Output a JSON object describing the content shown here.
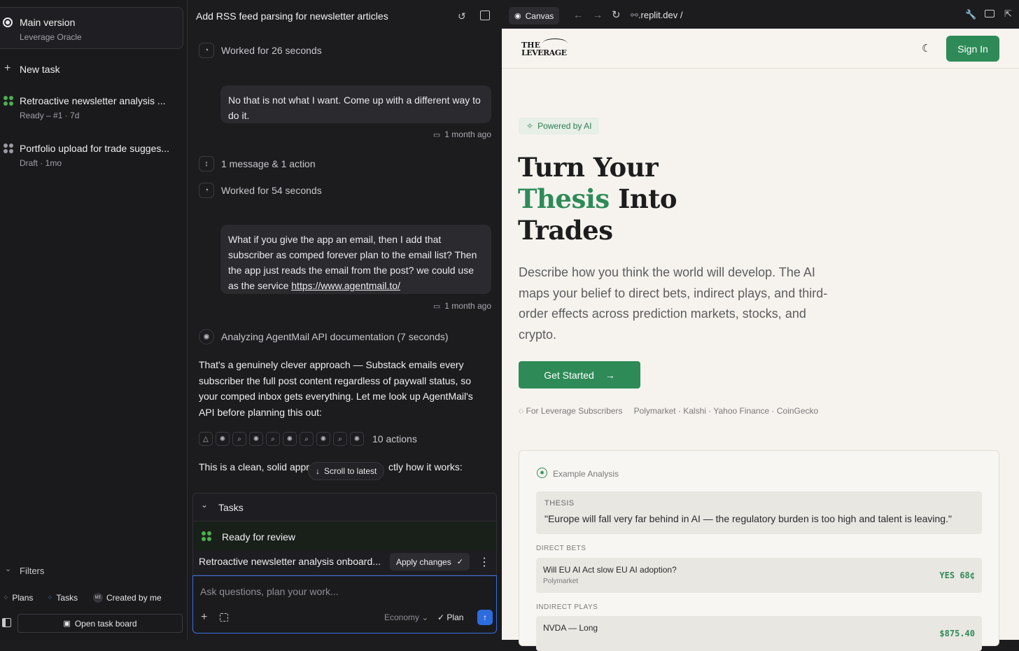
{
  "sidebar": {
    "main_version": {
      "title": "Main version",
      "subtitle": "Leverage Oracle"
    },
    "new_task_label": "New task",
    "tasks": [
      {
        "title": "Retroactive newsletter analysis ...",
        "meta": "Ready – #1 · 7d"
      },
      {
        "title": "Portfolio upload for trade sugges...",
        "meta": "Draft · 1mo"
      }
    ],
    "filters_label": "Filters",
    "chips": {
      "plans": "Plans",
      "tasks": "Tasks",
      "created_by_me": "Created by me",
      "avatar_initials": "ME"
    },
    "open_board_label": "Open task board"
  },
  "chat": {
    "title": "Add RSS feed parsing for newsletter articles",
    "worked_1": "Worked for 26 seconds",
    "msg_1": "No that is not what I want. Come up with a different way to do it.",
    "msg_1_time": "1 month ago",
    "collapsed": "1 message & 1 action",
    "worked_2": "Worked for 54 seconds",
    "msg_2_text": "What if you give the app an email, then I add that subscriber as comped forever plan to the email list? Then the app just reads the email from the post? we could use as the service ",
    "msg_2_link": "https://www.agentmail.to/",
    "msg_2_time": "1 month ago",
    "analyzing": "Analyzing AgentMail API documentation (7 seconds)",
    "reply": "That's a genuinely clever approach — Substack emails every subscriber the full post content regardless of paywall status, so your comped inbox gets everything. Let me look up AgentMail's API before planning this out:",
    "actions_count": "10 actions",
    "partial_start": "This is a clean, solid appr",
    "partial_end": "ctly how it works:",
    "scroll_label": "Scroll to latest",
    "tasks_header": "Tasks",
    "ready_label": "Ready for review",
    "task_name": "Retroactive newsletter analysis onboard...",
    "apply_label": "Apply changes",
    "composer_placeholder": "Ask questions, plan your work...",
    "model_label": "Economy",
    "plan_label": "Plan"
  },
  "browser": {
    "canvas_label": "Canvas",
    "url": ".replit.dev /",
    "logo_text_1": "THE",
    "logo_text_2": "LEVERAGE",
    "signin_label": "Sign In",
    "badge": "Powered by AI",
    "hero_line1": "Turn Your",
    "hero_green": "Thesis",
    "hero_line2_rest": " Into",
    "hero_line3": "Trades",
    "description": "Describe how you think the world will develop. The AI maps your belief to direct bets, indirect plays, and third-order effects across prediction markets, stocks, and crypto.",
    "cta_label": "Get Started",
    "subscribers_label": "For Leverage Subscribers",
    "sources_label": "Polymarket · Kalshi · Yahoo Finance · CoinGecko",
    "example": {
      "heading": "Example Analysis",
      "thesis_label": "THESIS",
      "thesis_text": "\"Europe will fall very far behind in AI — the regulatory burden is too high and talent is leaving.\"",
      "direct_label": "DIRECT BETS",
      "direct": {
        "question": "Will EU AI Act slow EU AI adoption?",
        "platform": "Polymarket",
        "value": "YES 68¢"
      },
      "indirect_label": "INDIRECT PLAYS",
      "indirect": {
        "question": "NVDA — Long",
        "value": "$875.40"
      }
    }
  },
  "colors": {
    "accent_green": "#2e8b57",
    "focus_blue": "#3b6ee0",
    "dark_bg": "#1c1c1f",
    "page_bg": "#f6f3ee"
  }
}
